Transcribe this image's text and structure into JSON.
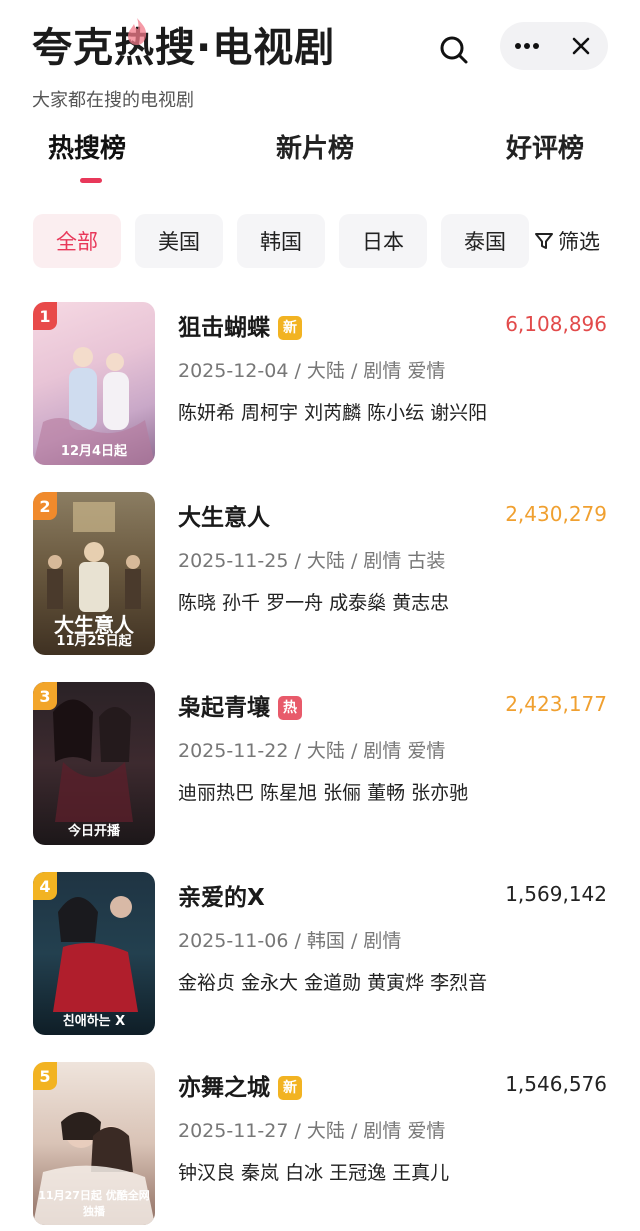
{
  "header": {
    "title": "夸克热搜·电视剧",
    "subtitle": "大家都在搜的电视剧"
  },
  "tabs": [
    {
      "label": "热搜榜",
      "active": true
    },
    {
      "label": "新片榜",
      "active": false
    },
    {
      "label": "好评榜",
      "active": false
    }
  ],
  "filters": {
    "chips": [
      "全部",
      "美国",
      "韩国",
      "日本",
      "泰国"
    ],
    "active": "全部",
    "filter_label": "筛选"
  },
  "colors": {
    "accent": "#e8385a",
    "rank1": "#e84a4a",
    "rank2": "#f08a2c",
    "rank3": "#f2a52a",
    "rank_other": "#f2b322",
    "heat_top": "#e24a4a",
    "heat_mid": "#f0a030",
    "heat_normal": "#222222"
  },
  "items": [
    {
      "rank": "1",
      "title": "狙击蝴蝶",
      "badge": "新",
      "heat": "6,108,896",
      "meta": "2025-12-04 / 大陆 / 剧情 爱情",
      "cast": "陈妍希 周柯宇 刘芮麟 陈小纭 谢兴阳",
      "poster_caption": "12月4日起"
    },
    {
      "rank": "2",
      "title": "大生意人",
      "badge": "",
      "heat": "2,430,279",
      "meta": "2025-11-25 / 大陆 / 剧情 古装",
      "cast": "陈晓 孙千 罗一舟 成泰燊 黄志忠",
      "poster_caption": "11月25日起"
    },
    {
      "rank": "3",
      "title": "枭起青壤",
      "badge": "热",
      "heat": "2,423,177",
      "meta": "2025-11-22 / 大陆 / 剧情 爱情",
      "cast": "迪丽热巴 陈星旭 张俪 董畅 张亦驰",
      "poster_caption": "今日开播"
    },
    {
      "rank": "4",
      "title": "亲爱的X",
      "badge": "",
      "heat": "1,569,142",
      "meta": "2025-11-06 / 韩国 / 剧情",
      "cast": "金裕贞 金永大 金道勋 黄寅烨 李烈音",
      "poster_caption": "친애하는 X"
    },
    {
      "rank": "5",
      "title": "亦舞之城",
      "badge": "新",
      "heat": "1,546,576",
      "meta": "2025-11-27 / 大陆 / 剧情 爱情",
      "cast": "钟汉良 秦岚 白冰 王冠逸 王真儿",
      "poster_caption": "11月27日起 优酷全网独播"
    }
  ]
}
